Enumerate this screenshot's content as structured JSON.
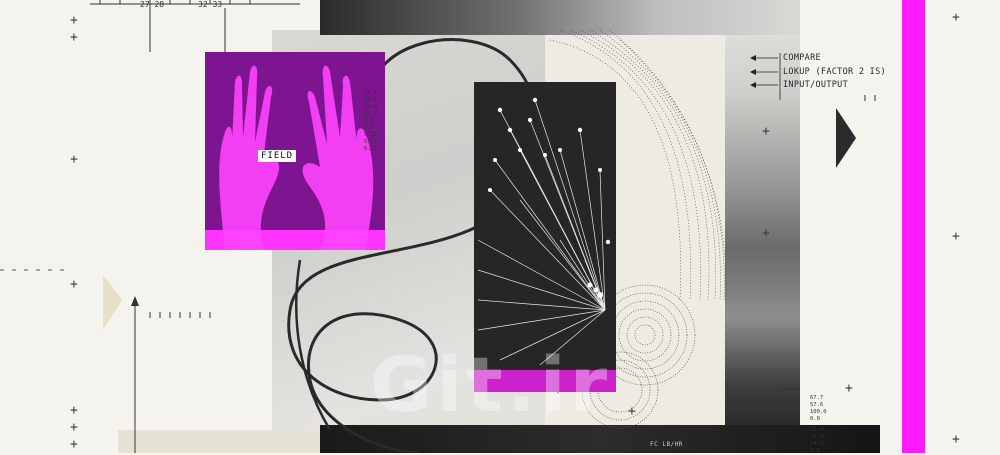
{
  "ruler": {
    "left_pair": "27 28",
    "right_pair": "32 33"
  },
  "hands_panel": {
    "field_label": "FIELD"
  },
  "callouts": [
    "COMPARE",
    "LOKUP (FACTOR 2 IS)",
    "INPUT/OUTPUT"
  ],
  "readout_values": [
    "67.7",
    "57.6",
    "100.0",
    "0.0",
    "21.4",
    "21.3",
    "24.9",
    "0.0"
  ],
  "bottom_caption": "FC LB/HR",
  "watermark": "Git.ir",
  "colors": {
    "accent_magenta": "#ff1aff",
    "panel_purple": "#7d1590",
    "dark_panel": "#262626",
    "background": "#f4f3ee"
  }
}
